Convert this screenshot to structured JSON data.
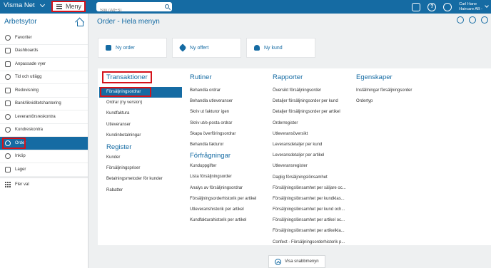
{
  "topbar": {
    "brand": "Visma Net",
    "menu_label": "Meny",
    "search_placeholder": "Sök (Alt+S)",
    "user_name": "Carl Hane",
    "company": "Haircare AB -"
  },
  "sidebar": {
    "title": "Arbetsytor",
    "items": [
      {
        "label": "Favoriter",
        "icon": "star-icon"
      },
      {
        "label": "Dashboards",
        "icon": "dashboard-icon"
      },
      {
        "label": "Anpassade vyer",
        "icon": "custom-views-icon"
      },
      {
        "label": "Tid och utlägg",
        "icon": "clock-icon"
      },
      {
        "label": "Redovisning",
        "icon": "ledger-icon"
      },
      {
        "label": "Bank/likviditetshantering",
        "icon": "bank-icon"
      },
      {
        "label": "Leverantörsreskontra",
        "icon": "minus-circle-icon"
      },
      {
        "label": "Kundreskontra",
        "icon": "plus-circle-icon"
      },
      {
        "label": "Order",
        "icon": "order-icon"
      },
      {
        "label": "Inköp",
        "icon": "purchase-icon"
      },
      {
        "label": "Lager",
        "icon": "stock-icon"
      }
    ],
    "more_label": "Fler val"
  },
  "main": {
    "title": "Order - Hela menyn",
    "quick_actions": [
      "Ny order",
      "Ny offert",
      "Ny kund"
    ],
    "columns": {
      "transaktioner": {
        "title": "Transaktioner",
        "links": [
          "Försäljningsordrar",
          "Ordrar (ny version)",
          "Kundfaktura",
          "Utleveranser",
          "Kundinbetalningar"
        ]
      },
      "register": {
        "title": "Register",
        "links": [
          "Kunder",
          "Försäljningspriser",
          "Betalningsmetoder för kunder",
          "Rabatter"
        ]
      },
      "rutiner": {
        "title": "Rutiner",
        "links": [
          "Behandla ordrar",
          "Behandla utleveranser",
          "Skriv ut fakturor igen",
          "Skriv ut/e-posta ordrar",
          "Skapa överföringsordrar",
          "Behandla fakturor"
        ]
      },
      "forfragningar": {
        "title": "Förfrågningar",
        "links": [
          "Kunduppgifter",
          "Lista försäljningsorder",
          "Analys av försäljningsordrar",
          "Försäljningsorderhistorik per artikel",
          "Utleveranshistorik per artikel",
          "Kundfakturahistorik per artikel"
        ]
      },
      "rapporter": {
        "title": "Rapporter",
        "links": [
          "Översikt försäljningsorder",
          "Detaljer försäljningsorder per kund",
          "Detaljer försäljningsorder per artikel",
          "Orderregister",
          "Utleveransöversikt",
          "Leveransdetaljer per kund",
          "Leveransdetaljer per artikel",
          "Utleveransregister",
          "Daglig försäljningslönsamhet",
          "Försäljningslönsamhet per säljare oc...",
          "Försäljningslönsamhet per kundklas...",
          "Försäljningslönsamhet per kund och...",
          "Försäljningslönsamhet per artikel oc...",
          "Försäljningslönsamhet per artikelkla...",
          "Confect - Försäljningsorderhistorik p..."
        ]
      },
      "egenskaper": {
        "title": "Egenskaper",
        "links": [
          "Inställningar försäljningsorder",
          "Ordertyp"
        ]
      }
    },
    "snabbmeny_label": "Visa snabbmenyn"
  }
}
